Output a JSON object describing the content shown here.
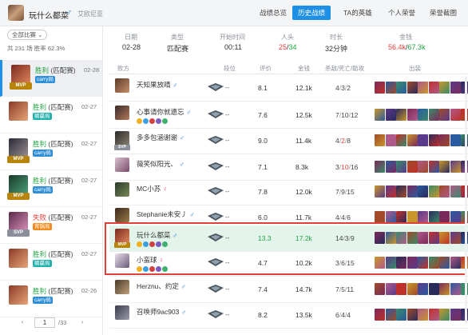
{
  "header": {
    "player_name": "玩什么都菜",
    "gender_symbol": "♂",
    "area": "艾欧尼亚",
    "tabs": [
      {
        "label": "战绩总览"
      },
      {
        "label": "历史战绩"
      },
      {
        "label": "TA的英雄"
      },
      {
        "label": "个人荣誉"
      },
      {
        "label": "荣誉截图"
      }
    ]
  },
  "left": {
    "filter_label": "全部比赛 ⌄",
    "total_prefix": "共",
    "total": "231",
    "total_suffix": "场",
    "winrate_label": "胜率",
    "winrate": "62.3%",
    "games": [
      {
        "result": "胜利",
        "mode": "(匹配赛)",
        "tag": "carry局",
        "date": "02-28",
        "badge": "MVP"
      },
      {
        "result": "胜利",
        "mode": "(匹配赛)",
        "tag": "躺赢局",
        "date": "02-27",
        "badge": ""
      },
      {
        "result": "胜利",
        "mode": "(匹配赛)",
        "tag": "carry局",
        "date": "02-27",
        "badge": "MVP"
      },
      {
        "result": "胜利",
        "mode": "(匹配赛)",
        "tag": "carry局",
        "date": "02-27",
        "badge": "MVP"
      },
      {
        "result": "失败",
        "mode": "(匹配赛)",
        "tag": "背锅局",
        "date": "02-27",
        "badge": "SVP"
      },
      {
        "result": "胜利",
        "mode": "(匹配赛)",
        "tag": "躺赢局",
        "date": "02-27",
        "badge": ""
      },
      {
        "result": "胜利",
        "mode": "(匹配赛)",
        "tag": "carry局",
        "date": "02-26",
        "badge": ""
      }
    ],
    "pager": {
      "prev": "‹",
      "page": "1",
      "total": "/33",
      "next": "›"
    }
  },
  "summary": {
    "date_label": "日期",
    "date": "02-28",
    "type_label": "类型",
    "type": "匹配赛",
    "start_label": "开始时间",
    "start": "00:11",
    "kills_label": "人头",
    "kills_a": "25",
    "kills_sep": "/",
    "kills_b": "34",
    "duration_label": "时长",
    "duration": "32分钟",
    "gold_label": "金钱",
    "gold_a": "56.4k",
    "gold_sep": "/",
    "gold_b": "67.3k"
  },
  "table": {
    "headers": [
      "败方",
      "段位",
      "评价",
      "金钱",
      "杀敌/死亡/助攻",
      "出装"
    ],
    "rank_text": "--",
    "rows": [
      {
        "name": "天知果放晴",
        "gender": "♂",
        "score": "8.1",
        "gold": "12.1k",
        "k": "4",
        "d": "3",
        "a": "2",
        "d_red": false,
        "mvp": ""
      },
      {
        "name": "心事请你就遗忘",
        "gender": "♂",
        "score": "7.6",
        "gold": "12.5k",
        "k": "7",
        "d": "10",
        "a": "12",
        "d_red": false,
        "mvp": ""
      },
      {
        "name": "多多包涵谢谢",
        "gender": "♂",
        "score": "9.0",
        "gold": "11.4k",
        "k": "4",
        "d": "2",
        "a": "8",
        "d_red": true,
        "mvp": "SVP"
      },
      {
        "name": "薇笑似阳光、",
        "gender": "♂",
        "score": "7.1",
        "gold": "8.3k",
        "k": "3",
        "d": "10",
        "a": "16",
        "d_red": true,
        "mvp": ""
      },
      {
        "name": "MC小苏",
        "gender": "♀",
        "score": "7.8",
        "gold": "12.0k",
        "k": "7",
        "d": "9",
        "a": "15",
        "d_red": false,
        "mvp": ""
      },
      {
        "name": "Stephanie未安丿",
        "gender": "♂",
        "score": "6.0",
        "gold": "11.7k",
        "k": "4",
        "d": "4",
        "a": "6",
        "d_red": false,
        "mvp": ""
      },
      {
        "name": "玩什么都菜",
        "gender": "♂",
        "score": "13.3",
        "gold": "17.2k",
        "k": "14",
        "d": "3",
        "a": "9",
        "d_red": false,
        "mvp": "MVP"
      },
      {
        "name": "小蛮球",
        "gender": "♀",
        "score": "4.7",
        "gold": "10.2k",
        "k": "3",
        "d": "6",
        "a": "15",
        "d_red": false,
        "mvp": ""
      },
      {
        "name": "Herznu、约定",
        "gender": "♂",
        "score": "7.4",
        "gold": "14.7k",
        "k": "7",
        "d": "5",
        "a": "11",
        "d_red": false,
        "mvp": ""
      },
      {
        "name": "召唤师9ac903",
        "gender": "♂",
        "score": "8.2",
        "gold": "13.5k",
        "k": "6",
        "d": "4",
        "a": "4",
        "d_red": false,
        "mvp": ""
      }
    ]
  },
  "colors": {
    "accent": "#1e90e6",
    "win": "#22a243",
    "lose": "#e5403c",
    "highlight_row": "#e3f4ea",
    "annotation_box": "#e0403a"
  }
}
